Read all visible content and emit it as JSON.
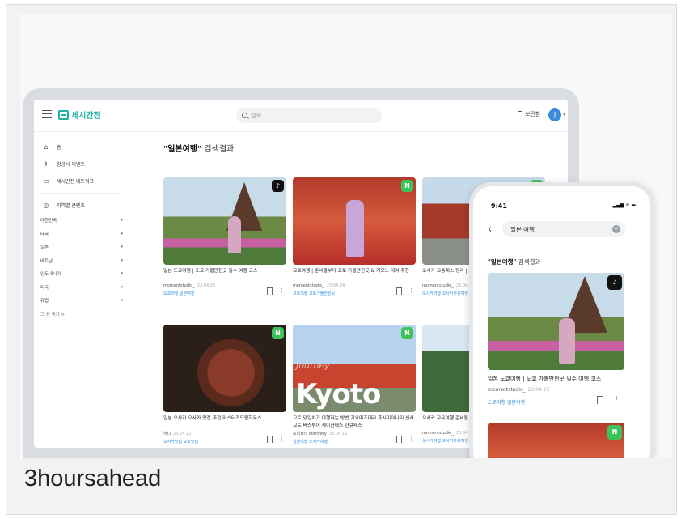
{
  "caption": "3hoursahead",
  "app": {
    "logo_text": "세시간전",
    "search_placeholder": "검색",
    "bookmark_label": "보관함",
    "avatar_initial": "J"
  },
  "sidebar": {
    "items": [
      {
        "icon": "home-icon",
        "glyph": "⌂",
        "label": "홈"
      },
      {
        "icon": "plane-icon",
        "glyph": "✈",
        "label": "항공사 이벤트"
      },
      {
        "icon": "network-icon",
        "glyph": "▭",
        "label": "세시간전 네트워크"
      },
      {
        "icon": "region-icon",
        "glyph": "◎",
        "label": "지역별 콘텐츠"
      }
    ],
    "regions": [
      "대한민국",
      "태국",
      "일본",
      "베트남",
      "인도네시아",
      "미국",
      "유럽"
    ],
    "more_label": "그 외 국가 >"
  },
  "results": {
    "query": "\"일본여행\"",
    "suffix": " 검색결과"
  },
  "cards": [
    {
      "title": "일본 도쿄여행 | 도쿄 가볼만한곳 필수 여행 코스",
      "author": "momentstudio_",
      "date": "23.04.25",
      "tags": "도쿄여행  일본여행",
      "badge": "♪",
      "badge_type": "tiktok-badge"
    },
    {
      "title": "교토여행 | 준비물부터 교토 가볼만한곳 & 기모노 대여 추천",
      "author": "momentstudio_",
      "date": "23.04.24",
      "tags": "교토여행  교토가볼만한곳",
      "badge": "N",
      "badge_type": "naver-badge"
    },
    {
      "title": "오사카 교통패스 정리 | 고베 패스 예약",
      "author": "momentstudio_",
      "date": "23.04.19",
      "tags": "오사카여행  오사카자유여행",
      "badge": "N",
      "badge_type": "naver-badge"
    },
    {
      "title": "일본 오사카 오사카 맛집 추천 마스터즈드림하우스",
      "author": "허니",
      "date": "23.04.12",
      "tags": "오사카맛집  교토맛집",
      "badge": "N",
      "badge_type": "naver-badge"
    },
    {
      "title": "교토 당일치기 여행하는 방법 기요미즈데라 후시미이나리 신사 교토 버스투어 제이한패스 한큐패스",
      "author": "모리브리 Morivery",
      "date": "23.04.12",
      "tags": "일본여행  오사카여행",
      "badge": "N",
      "badge_type": "naver-badge",
      "overlay_big": "Kyoto",
      "overlay_small": "Journey"
    },
    {
      "title": "오사카 자유여행 준비물 | 간 항에서 시내 가는 법",
      "author": "momentstudio_",
      "date": "23.04.12",
      "tags": "오사카여행  오사카자유여행",
      "badge": "",
      "badge_type": "none"
    }
  ],
  "phone": {
    "time": "9:41",
    "status": "▂▄▆ ≋ ▬",
    "search_value": "일본 여행",
    "results_query": "\"일본여행\"",
    "results_suffix": " 검색결과",
    "card": {
      "title": "일본 도쿄여행 | 도쿄 가볼만한곳 필수 여행 코스",
      "author": "momentstudio_",
      "date": "23.04.25",
      "tags": "도쿄여행  일본여행",
      "badge": "♪"
    },
    "card2_badge": "N"
  }
}
